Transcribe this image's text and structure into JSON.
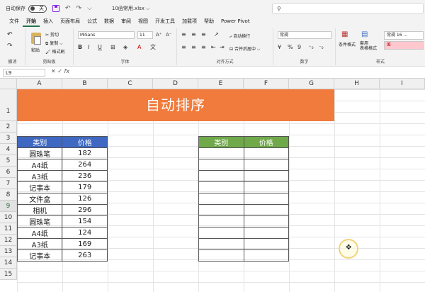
{
  "titlebar": {
    "autosave_label": "自动保存",
    "toggle_state": "关",
    "filename": "10函常用.xlsx ⌵",
    "search_icon": "search-icon"
  },
  "menu": {
    "tabs": [
      "文件",
      "开始",
      "插入",
      "页面布局",
      "公式",
      "数据",
      "审阅",
      "视图",
      "开发工具",
      "加载项",
      "帮助",
      "Power Pivot"
    ],
    "active_index": 1
  },
  "ribbon": {
    "undo_group": "撤消",
    "clipboard": {
      "paste": "粘贴",
      "cut": "剪切",
      "copy": "复制 ⌵",
      "format_painter": "格式刷",
      "title": "剪贴板"
    },
    "font": {
      "name": "MiSans",
      "size": "11",
      "title": "字体",
      "bold": "B",
      "italic": "I",
      "underline": "U"
    },
    "alignment": {
      "wrap": "自动换行",
      "merge": "合并后居中 ⌵",
      "title": "对齐方式"
    },
    "number": {
      "format": "常规",
      "percent": "%",
      "comma": "9",
      "title": "数字"
    },
    "styles": {
      "conditional": "条件格式",
      "table": "套用\n表格格式",
      "normal_cell": "常规 16 ...",
      "bad_cell": "差",
      "title": "样式"
    }
  },
  "formula_bar": {
    "name_box": "L9",
    "fx": "fx",
    "value": ""
  },
  "grid": {
    "columns": [
      "A",
      "B",
      "C",
      "D",
      "E",
      "F",
      "G",
      "H",
      "I"
    ],
    "rows": [
      "1",
      "2",
      "3",
      "4",
      "5",
      "6",
      "7",
      "8",
      "9",
      "10",
      "11",
      "12",
      "13",
      "14",
      "15"
    ],
    "selected_row": "9"
  },
  "sheet": {
    "banner": "自动排序",
    "left_table": {
      "headers": [
        "类别",
        "价格"
      ],
      "rows": [
        [
          "圆珠笔",
          "182"
        ],
        [
          "A4纸",
          "264"
        ],
        [
          "A3纸",
          "236"
        ],
        [
          "记事本",
          "179"
        ],
        [
          "文件盒",
          "126"
        ],
        [
          "相机",
          "296"
        ],
        [
          "圆珠笔",
          "154"
        ],
        [
          "A4纸",
          "124"
        ],
        [
          "A3纸",
          "169"
        ],
        [
          "记事本",
          "263"
        ]
      ]
    },
    "right_table": {
      "headers": [
        "类别",
        "价格"
      ],
      "row_count": 10
    }
  },
  "colors": {
    "banner": "#f07b3c",
    "left_header": "#3e68c2",
    "right_header": "#70a94a",
    "excel_green": "#217346"
  }
}
